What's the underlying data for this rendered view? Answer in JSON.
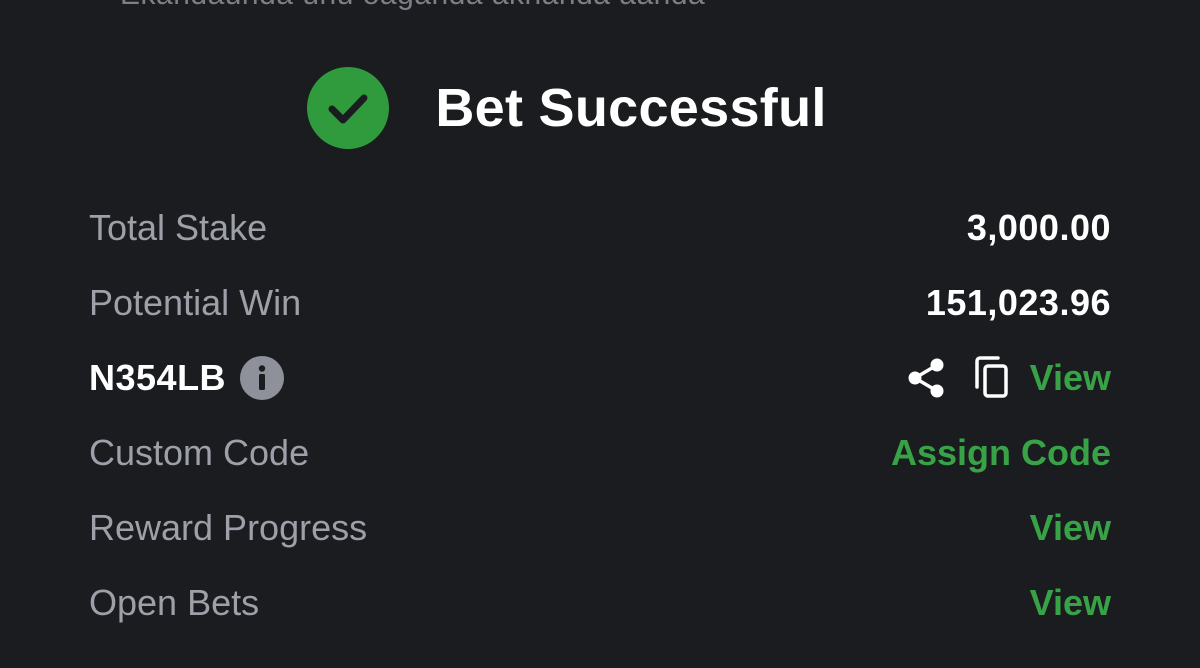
{
  "top_cutoff_text": "Ekandaunda unu oaganda aknanda aanda",
  "header": {
    "title": "Bet Successful",
    "icon": "check-circle-icon",
    "icon_color": "#2f9b3c"
  },
  "summary": {
    "total_stake_label": "Total Stake",
    "total_stake_value": "3,000.00",
    "potential_win_label": "Potential Win",
    "potential_win_value": "151,023.96",
    "booking_code": "N354LB",
    "booking_code_view": "View",
    "custom_code_label": "Custom Code",
    "custom_code_action": "Assign Code",
    "reward_progress_label": "Reward Progress",
    "reward_progress_action": "View",
    "open_bets_label": "Open Bets",
    "open_bets_action": "View"
  },
  "colors": {
    "background": "#1b1c20",
    "accent_green": "#37a346",
    "label_gray": "#9da0a8",
    "value_white": "#ffffff"
  },
  "icons": [
    "check-circle-icon",
    "info-icon",
    "share-icon",
    "copy-icon"
  ]
}
